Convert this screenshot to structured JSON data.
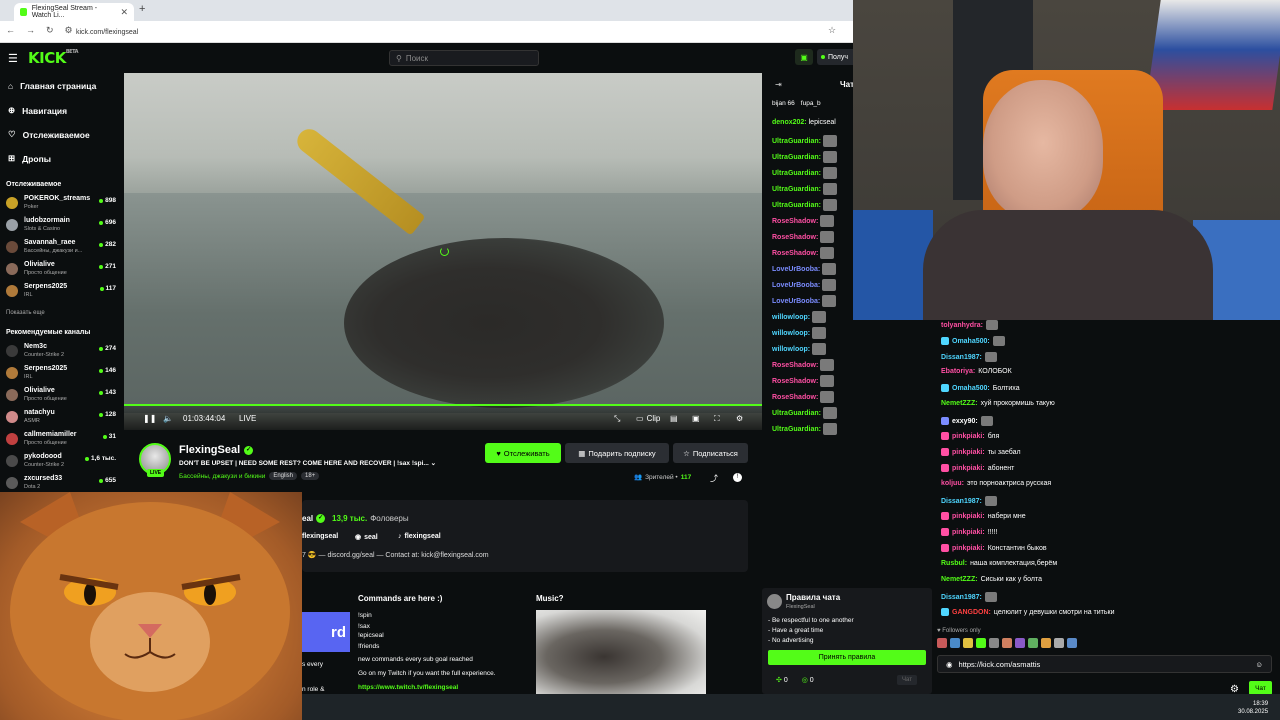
{
  "browser": {
    "tab_title": "FlexingSeal Stream - Watch Li...",
    "url": "kick.com/flexingseal"
  },
  "header": {
    "logo": "KICK",
    "logo_badge": "BETA",
    "search_placeholder": "Поиск",
    "get_button": "Получ"
  },
  "sidebar": {
    "nav": [
      {
        "label": "Главная страница",
        "icon": "home-icon"
      },
      {
        "label": "Навигация",
        "icon": "compass-icon"
      },
      {
        "label": "Отслеживаемое",
        "icon": "heart-icon"
      },
      {
        "label": "Дропы",
        "icon": "gift-icon"
      }
    ],
    "following_header": "Отслеживаемое",
    "following": [
      {
        "name": "POKEROK_streams",
        "category": "Poker",
        "viewers": "898",
        "color": "#c9a227"
      },
      {
        "name": "ludobzormain",
        "category": "Slots & Casino",
        "viewers": "696",
        "color": "#9aa0a6"
      },
      {
        "name": "Savannah_raee",
        "category": "Бассейны, джакузи и...",
        "viewers": "282",
        "color": "#6a4a3a"
      },
      {
        "name": "Olivialive",
        "category": "Просто общение",
        "viewers": "271",
        "color": "#8a6a5a"
      },
      {
        "name": "Serpens2025",
        "category": "IRL",
        "viewers": "117",
        "color": "#b07a3a"
      }
    ],
    "show_more_1": "Показать еще",
    "recommended_header": "Рекомендуемые каналы",
    "recommended": [
      {
        "name": "Nem3c",
        "category": "Counter-Strike 2",
        "viewers": "274",
        "color": "#3a3a3a"
      },
      {
        "name": "Serpens2025",
        "category": "IRL",
        "viewers": "146",
        "color": "#b07a3a"
      },
      {
        "name": "Olivialive",
        "category": "Просто общение",
        "viewers": "143",
        "color": "#8a6a5a"
      },
      {
        "name": "natachyu",
        "category": "ASMR",
        "viewers": "128",
        "color": "#d08a8a"
      },
      {
        "name": "callmemiamiller",
        "category": "Просто общение",
        "viewers": "31",
        "color": "#c04040"
      },
      {
        "name": "pykodoood",
        "category": "Counter-Strike 2",
        "viewers": "1,6 тыс.",
        "color": "#4a4a4a"
      },
      {
        "name": "zxcursed33",
        "category": "Dota 2",
        "viewers": "655",
        "color": "#5a5a5a"
      }
    ]
  },
  "player": {
    "time": "01:03:44:04",
    "live": "LIVE",
    "clip": "Clip"
  },
  "stream": {
    "name": "FlexingSeal",
    "title": "DON'T BE UPSET | NEED SOME REST? COME HERE AND RECOVER | !sax !spi...",
    "category": "Бассейны, джакузи и бикини",
    "tag_lang": "English",
    "tag_age": "18+",
    "follow": "Отслеживать",
    "gift": "Подарить подписку",
    "subscribe": "Подписаться",
    "viewers_label": "Зрителей •",
    "viewers_count": "117",
    "live_badge": "LIVE"
  },
  "about": {
    "name_fragment": "eal",
    "followers_count": "13,9 тыс.",
    "followers_label": "Фоловеры",
    "social_1": "flexingseal",
    "social_2": "seal",
    "social_3": "flexingseal",
    "bio": "7 😎 — discord.gg/seal — Contact at: kick@flexingseal.com"
  },
  "panels": {
    "blue_text": "rd",
    "left_frag_1": "s every",
    "left_frag_2": "n role &",
    "cmd_title": "Commands are here :)",
    "cmd_lines": [
      "!spin",
      "!sax",
      "!epicseal",
      "!friends"
    ],
    "cmd_extra_1": "new commands every sub goal reached",
    "cmd_extra_2": "Go on my Twitch if you want the full experience.",
    "cmd_link": "https://www.twitch.tv/flexingseal",
    "music_title": "Music?"
  },
  "chat_mid": {
    "header_left": "⇥",
    "header_right": "Чат",
    "pinned_1": "bijan 66",
    "pinned_2": "fupa_b",
    "messages": [
      {
        "user": "denox202:",
        "text": "lepicseal",
        "color": "#53fc18"
      },
      {
        "user": "UltraGuardian:",
        "text": "",
        "color": "#53fc18"
      },
      {
        "user": "UltraGuardian:",
        "text": "",
        "color": "#53fc18"
      },
      {
        "user": "UltraGuardian:",
        "text": "",
        "color": "#53fc18"
      },
      {
        "user": "UltraGuardian:",
        "text": "",
        "color": "#53fc18"
      },
      {
        "user": "UltraGuardian:",
        "text": "",
        "color": "#53fc18"
      },
      {
        "user": "RoseShadow:",
        "text": "",
        "color": "#ff4fa3"
      },
      {
        "user": "RoseShadow:",
        "text": "",
        "color": "#ff4fa3"
      },
      {
        "user": "RoseShadow:",
        "text": "",
        "color": "#ff4fa3"
      },
      {
        "user": "LoveUrBooba:",
        "text": "",
        "color": "#7b8cff"
      },
      {
        "user": "LoveUrBooba:",
        "text": "",
        "color": "#7b8cff"
      },
      {
        "user": "LoveUrBooba:",
        "text": "",
        "color": "#7b8cff"
      },
      {
        "user": "willowloop:",
        "text": "",
        "color": "#4fd6ff"
      },
      {
        "user": "willowloop:",
        "text": "",
        "color": "#4fd6ff"
      },
      {
        "user": "willowloop:",
        "text": "",
        "color": "#4fd6ff"
      },
      {
        "user": "RoseShadow:",
        "text": "",
        "color": "#ff4fa3"
      },
      {
        "user": "RoseShadow:",
        "text": "",
        "color": "#ff4fa3"
      },
      {
        "user": "RoseShadow:",
        "text": "",
        "color": "#ff4fa3"
      },
      {
        "user": "UltraGuardian:",
        "text": "",
        "color": "#53fc18"
      },
      {
        "user": "UltraGuardian:",
        "text": "",
        "color": "#53fc18"
      }
    ]
  },
  "rules": {
    "title": "Правила чата",
    "sub": "FlexingSeal",
    "items": [
      "- Be respectful to one another",
      "- Have a great time",
      "- No advertising"
    ],
    "accept": "Принять правила",
    "points_1": "0",
    "points_2": "0",
    "chat_btn": "Чат"
  },
  "chat_right": {
    "messages": [
      {
        "user": "tolyanhydra:",
        "text": "",
        "color": "#ff4fa3",
        "badge": ""
      },
      {
        "user": "Omaha500:",
        "text": "",
        "color": "#4fd6ff",
        "badge": "#4fd6ff"
      },
      {
        "user": "Dissan1987:",
        "text": "",
        "color": "#4fd6ff",
        "badge": ""
      },
      {
        "user": "Ebatoriya:",
        "text": "КОЛОБОК",
        "color": "#ff4fa3",
        "badge": ""
      },
      {
        "user": "Omaha500:",
        "text": "Болтиха",
        "color": "#4fd6ff",
        "badge": "#4fd6ff"
      },
      {
        "user": "NemetZZZ:",
        "text": "хуй прокормишь такую",
        "color": "#53fc18",
        "badge": ""
      },
      {
        "user": "exxy90:",
        "text": "",
        "color": "#ffffff",
        "badge": "#7b8cff"
      },
      {
        "user": "pinkpiaki:",
        "text": "бля",
        "color": "#ff4fa3",
        "badge": "#ff4fa3"
      },
      {
        "user": "pinkpiaki:",
        "text": "ты заебал",
        "color": "#ff4fa3",
        "badge": "#ff4fa3"
      },
      {
        "user": "pinkpiaki:",
        "text": "абонент",
        "color": "#ff4fa3",
        "badge": "#ff4fa3"
      },
      {
        "user": "koljuu:",
        "text": "это порноактриса русская",
        "color": "#ff4fa3",
        "badge": ""
      },
      {
        "user": "Dissan1987:",
        "text": "",
        "color": "#4fd6ff",
        "badge": ""
      },
      {
        "user": "pinkpiaki:",
        "text": "набери мне",
        "color": "#ff4fa3",
        "badge": "#ff4fa3"
      },
      {
        "user": "pinkpiaki:",
        "text": "!!!!!",
        "color": "#ff4fa3",
        "badge": "#ff4fa3"
      },
      {
        "user": "pinkpiaki:",
        "text": "Константин быков",
        "color": "#ff4fa3",
        "badge": "#ff4fa3"
      },
      {
        "user": "Rusbul:",
        "text": "наша комплектация,берём",
        "color": "#53fc18",
        "badge": ""
      },
      {
        "user": "NemetZZZ:",
        "text": "Сиськи как у болта",
        "color": "#53fc18",
        "badge": ""
      },
      {
        "user": "Dissan1987:",
        "text": "",
        "color": "#4fd6ff",
        "badge": ""
      },
      {
        "user": "GANGDON:",
        "text": "целюлит у девушки смотри на титьки",
        "color": "#ff4040",
        "badge": "#4fd6ff"
      }
    ],
    "followers_only": "♥ Followers only",
    "input_value": "https://kick.com/asmattis",
    "send": "Чат"
  },
  "taskbar": {
    "time": "18:39",
    "date": "30.08.2025"
  },
  "colors": {
    "accent": "#53fc18",
    "bg": "#0b0e0f"
  }
}
